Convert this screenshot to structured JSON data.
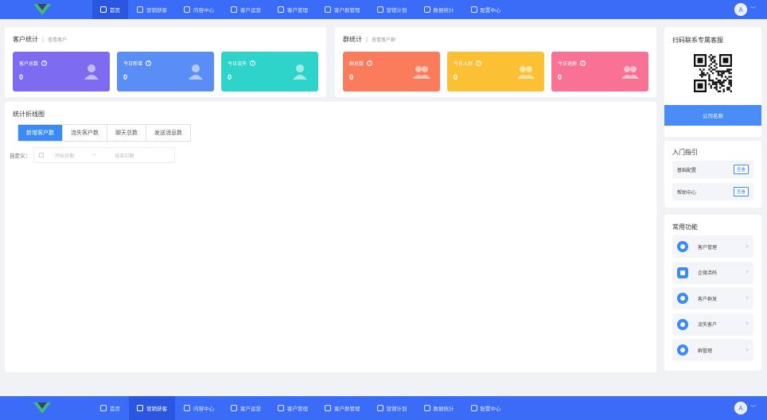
{
  "nav": {
    "top": {
      "items": [
        {
          "label": "首页",
          "active": true
        },
        {
          "label": "营销获客",
          "active": false
        },
        {
          "label": "内容中心",
          "active": false
        },
        {
          "label": "客户运营",
          "active": false
        },
        {
          "label": "客户管理",
          "active": false
        },
        {
          "label": "客户群管理",
          "active": false
        },
        {
          "label": "营销计划",
          "active": false
        },
        {
          "label": "数据统计",
          "active": false
        },
        {
          "label": "配置中心",
          "active": false
        }
      ]
    },
    "bottom": {
      "items": [
        {
          "label": "首页",
          "active": false
        },
        {
          "label": "营销获客",
          "active": true
        },
        {
          "label": "内容中心",
          "active": false
        },
        {
          "label": "客户运营",
          "active": false
        },
        {
          "label": "客户管理",
          "active": false
        },
        {
          "label": "客户群管理",
          "active": false
        },
        {
          "label": "营销计划",
          "active": false
        },
        {
          "label": "数据统计",
          "active": false
        },
        {
          "label": "配置中心",
          "active": false
        }
      ]
    },
    "avatar_glyph": "A",
    "caret": "﹀"
  },
  "customer_stats": {
    "title": "客户统计",
    "link": "查看客户",
    "cards": [
      {
        "label": "客户总数",
        "value": "0",
        "color": "#7b6cf2"
      },
      {
        "label": "今日新增",
        "value": "0",
        "color": "#5a8df5"
      },
      {
        "label": "今日流失",
        "value": "0",
        "color": "#2ed3c9"
      }
    ]
  },
  "group_stats": {
    "title": "群统计",
    "link": "查看客户群",
    "cards": [
      {
        "label": "群总数",
        "value": "0",
        "color": "#fb7c5c"
      },
      {
        "label": "今日入群",
        "value": "0",
        "color": "#fcc035"
      },
      {
        "label": "今日退群",
        "value": "0",
        "color": "#f97296"
      }
    ]
  },
  "chart_panel": {
    "title": "统计折线图",
    "tabs": [
      "新增客户数",
      "流失客户数",
      "聊天总数",
      "发送消息数"
    ],
    "active_tab": 0,
    "custom_label": "自定义：",
    "start_placeholder": "开始日期",
    "range_sep": "–",
    "end_placeholder": "结束日期"
  },
  "contact": {
    "title": "扫码联系专属客服",
    "company": "公司名称"
  },
  "guide": {
    "title": "入门指引",
    "rows": [
      {
        "label": "基础配置",
        "action": "查看"
      },
      {
        "label": "帮助中心",
        "action": "查看"
      }
    ]
  },
  "functions": {
    "title": "常用功能",
    "items": [
      {
        "label": "客户管理",
        "icon": "user-icon"
      },
      {
        "label": "企微活码",
        "icon": "qrcode-icon"
      },
      {
        "label": "客户群发",
        "icon": "broadcast-icon"
      },
      {
        "label": "流失客户",
        "icon": "user-lost-icon"
      },
      {
        "label": "群管理",
        "icon": "group-icon"
      }
    ],
    "chevron": ">"
  },
  "colors": {
    "brand": "#3b6cf7",
    "accent": "#3b8bf7"
  }
}
